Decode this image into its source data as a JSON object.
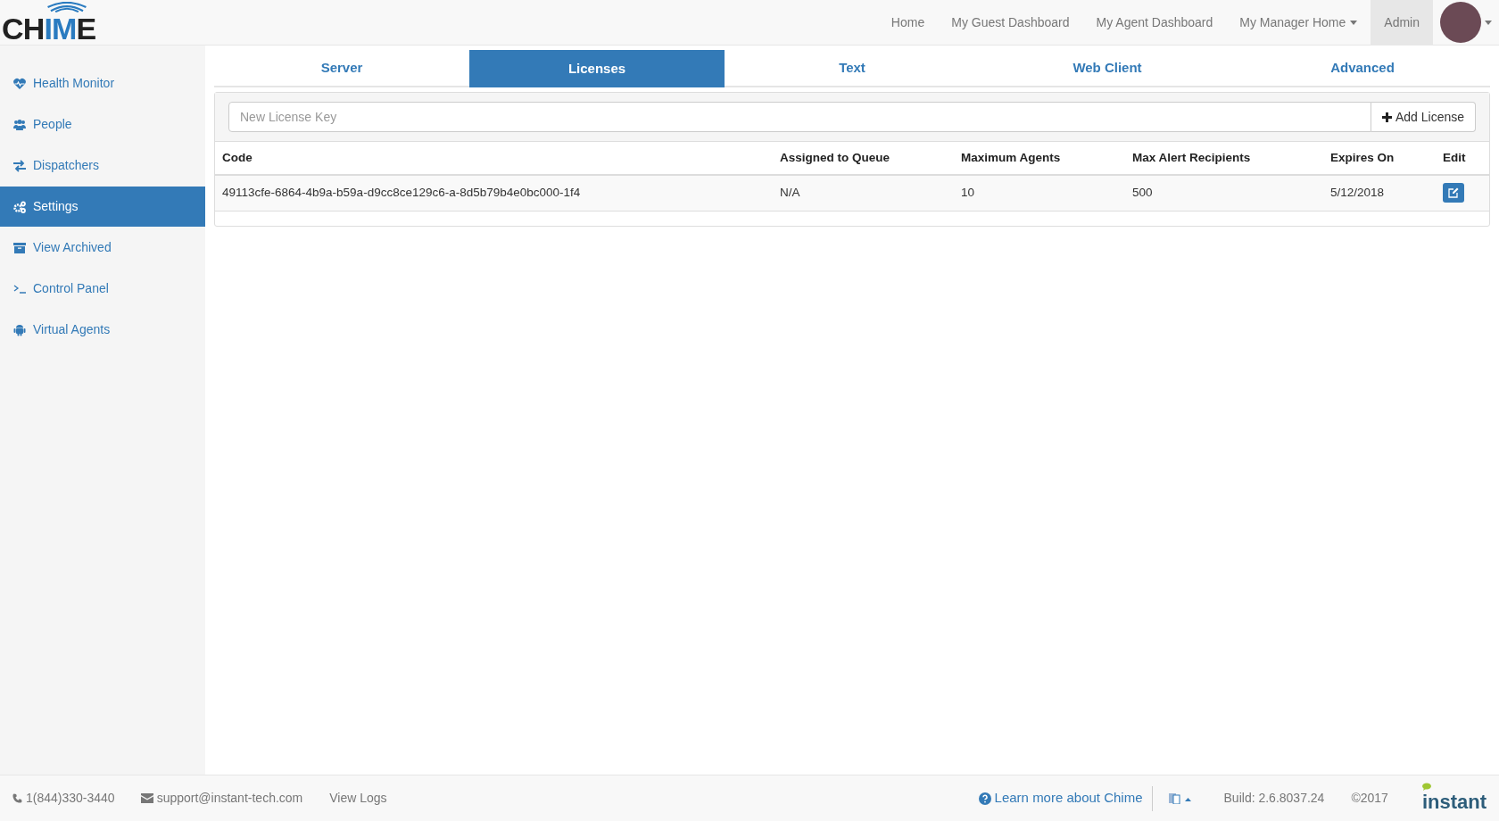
{
  "logo": {
    "parts": [
      {
        "text": "CH",
        "accent": false
      },
      {
        "text": "IM",
        "accent": true
      },
      {
        "text": "E",
        "accent": false
      }
    ]
  },
  "top_nav": [
    {
      "label": "Home",
      "dropdown": false,
      "selected": false
    },
    {
      "label": "My Guest Dashboard",
      "dropdown": false,
      "selected": false
    },
    {
      "label": "My Agent Dashboard",
      "dropdown": false,
      "selected": false
    },
    {
      "label": "My Manager Home",
      "dropdown": true,
      "selected": false
    },
    {
      "label": "Admin",
      "dropdown": false,
      "selected": true
    }
  ],
  "sidebar": {
    "items": [
      {
        "label": "Health Monitor",
        "kind": "heartbeat",
        "selected": false
      },
      {
        "label": "People",
        "kind": "users",
        "selected": false
      },
      {
        "label": "Dispatchers",
        "kind": "exchange",
        "selected": false
      },
      {
        "label": "Settings",
        "kind": "cogs",
        "selected": true
      },
      {
        "label": "View Archived",
        "kind": "archive",
        "selected": false
      },
      {
        "label": "Control Panel",
        "kind": "terminal",
        "selected": false
      },
      {
        "label": "Virtual Agents",
        "kind": "android",
        "selected": false
      }
    ]
  },
  "tabs": [
    {
      "label": "Server",
      "selected": false
    },
    {
      "label": "Licenses",
      "selected": true
    },
    {
      "label": "Text",
      "selected": false
    },
    {
      "label": "Web Client",
      "selected": false
    },
    {
      "label": "Advanced",
      "selected": false
    }
  ],
  "license_form": {
    "placeholder": "New License Key",
    "button": "Add License"
  },
  "table": {
    "columns": [
      "Code",
      "Assigned to Queue",
      "Maximum Agents",
      "Max Alert Recipients",
      "Expires On",
      "Edit"
    ],
    "rows": [
      {
        "cells": [
          "49113cfe-6864-4b9a-b59a-d9cc8ce129c6-a-8d5b79b4e0bc000-1f4",
          "N/A",
          "10",
          "500",
          "5/12/2018"
        ]
      }
    ]
  },
  "footer": {
    "phone": "1(844)330-3440",
    "email": "support@instant-tech.com",
    "logs": "View Logs",
    "learn_more": "Learn more about Chime",
    "build": "Build: 2.6.8037.24",
    "copyright": "©2017",
    "brand": "instant"
  }
}
